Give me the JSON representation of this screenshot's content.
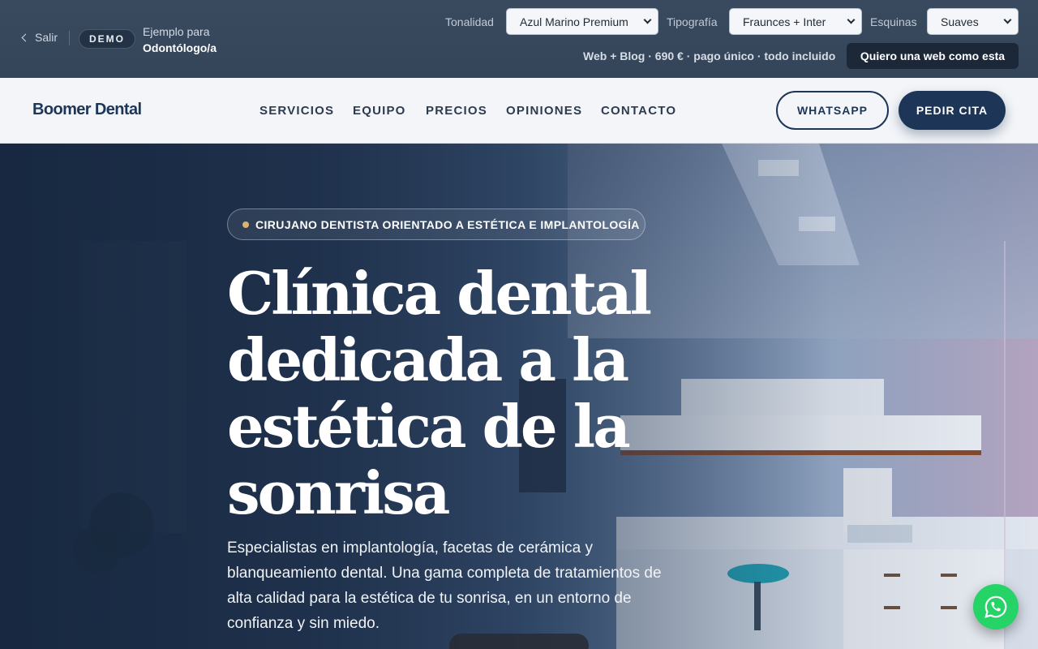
{
  "demobar": {
    "exit_label": "Salir",
    "badge": "DEMO",
    "example_line1": "Ejemplo para",
    "example_line2": "Odontólogo/a",
    "tonality_label": "Tonalidad",
    "tonality_value": "Azul Marino Premium",
    "typography_label": "Tipografía",
    "typography_value": "Fraunces + Inter",
    "corners_label": "Esquinas",
    "corners_value": "Suaves",
    "offer_text": "Web + Blog · 690 € · pago único · todo incluido",
    "cta_label": "Quiero una web como esta"
  },
  "nav": {
    "brand": "Boomer Dental",
    "items": [
      {
        "label": "SERVICIOS"
      },
      {
        "label": "EQUIPO"
      },
      {
        "label": "PRECIOS"
      },
      {
        "label": "OPINIONES"
      },
      {
        "label": "CONTACTO"
      }
    ],
    "whatsapp_label": "WHATSAPP",
    "appointment_label": "PEDIR CITA"
  },
  "hero": {
    "eyebrow": "CIRUJANO DENTISTA ORIENTADO A ESTÉTICA E IMPLANTOLOGÍA",
    "headline": "Clínica dental dedicada a la estética de la sonrisa",
    "lead": "Especialistas en implantología, facetas de cerámica y blanqueamiento dental. Una gama completa de tratamientos de alta calidad para la estética de tu sonrisa, en un entorno de confianza y sin miedo."
  },
  "icons": {
    "back": "chevron-left-icon",
    "whatsapp_float": "whatsapp-icon"
  },
  "colors": {
    "brand_navy": "#1d3557",
    "whatsapp_green": "#25d366",
    "accent_gold": "#d9b36c"
  }
}
